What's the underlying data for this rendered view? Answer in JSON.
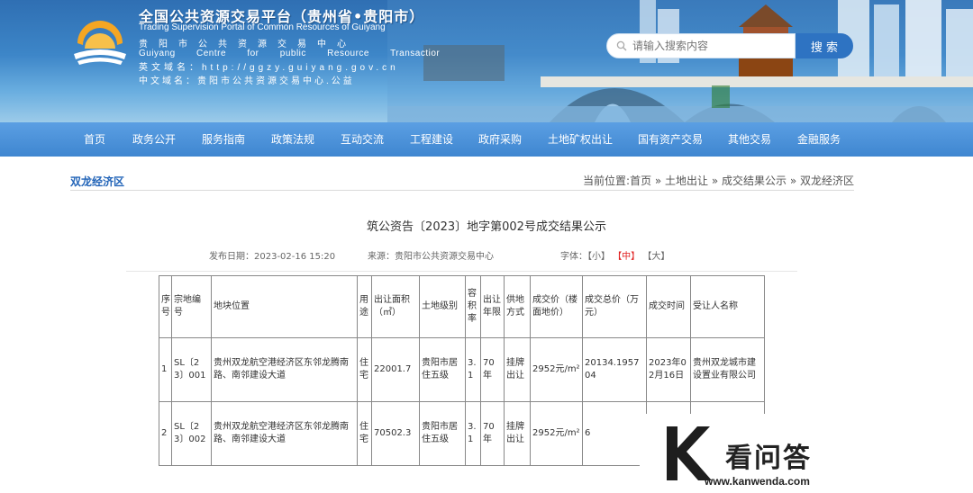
{
  "header": {
    "title": "全国公共资源交易平台（贵州省•贵阳市）",
    "subtitle_en": "Trading Supervision Portal of Common Resources of Guiyang",
    "center_cn": "贵阳市公共资源交易中心",
    "center_en": "Guiyang Centre for public Resource Transactior",
    "domain_en": "英文域名：http://ggzy.guiyang.gov.cn",
    "domain_cn": "中文域名：贵阳市公共资源交易中心.公益",
    "search_placeholder": "请输入搜索内容",
    "search_button": "搜 索"
  },
  "nav": [
    "首页",
    "政务公开",
    "服务指南",
    "政策法规",
    "互动交流",
    "工程建设",
    "政府采购",
    "土地矿权出让",
    "国有资产交易",
    "其他交易",
    "金融服务"
  ],
  "section": {
    "title": "双龙经济区",
    "breadcrumb": "当前位置:首页 » 土地出让 » 成交结果公示 » 双龙经济区"
  },
  "article": {
    "title": "筑公资告〔2023〕地字第002号成交结果公示",
    "date": "发布日期：2023-02-16 15:20",
    "source": "来源：贵阳市公共资源交易中心",
    "font_label": "字体：",
    "font_small": "【小】",
    "font_medium": "【中】",
    "font_large": "【大】"
  },
  "table": {
    "headers": [
      "序号",
      "宗地编号",
      "地块位置",
      "用途",
      "出让面积（㎡）",
      "土地级别",
      "容积率",
      "出让年限",
      "供地方式",
      "成交价（楼面地价）",
      "成交总价（万元）",
      "成交时间",
      "受让人名称"
    ],
    "rows": [
      [
        "1",
        "SL〔23〕001",
        "贵州双龙航空港经济区东邻龙腾南路、南邻建设大道",
        "住宅",
        "22001.7",
        "贵阳市居住五级",
        "3.1",
        "70年",
        "挂牌出让",
        "2952元/m²",
        "20134.195704",
        "2023年02月16日",
        "贵州双龙城市建设置业有限公司"
      ],
      [
        "2",
        "SL〔23〕002",
        "贵州双龙航空港经济区东邻龙腾南路、南邻建设大道",
        "住宅",
        "70502.3",
        "贵阳市居住五级",
        "3.1",
        "70年",
        "挂牌出让",
        "2952元/m²",
        "6",
        "",
        ""
      ]
    ]
  },
  "watermark": {
    "brand": "看问答",
    "url": "www.kanwenda.com"
  },
  "colors": {
    "nav_bg": "#4a8fd8",
    "link_blue": "#2264b8",
    "accent_red": "#e02020"
  }
}
